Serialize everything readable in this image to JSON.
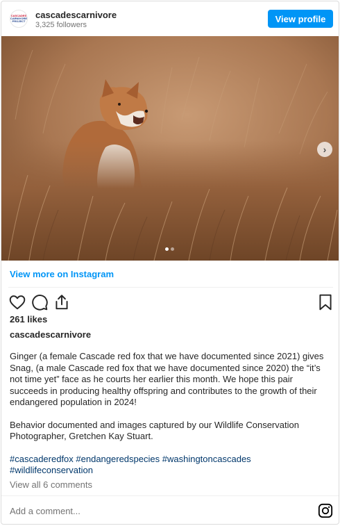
{
  "header": {
    "avatar_lines": [
      "CASCADES",
      "CARNIVORE",
      "PROJECT"
    ],
    "username": "cascadescarnivore",
    "followers": "3,325 followers",
    "view_profile_label": "View profile"
  },
  "media": {
    "slide_count": 2,
    "active_slide": 1,
    "next_icon": "chevron-right-icon"
  },
  "links": {
    "view_more": "View more on Instagram"
  },
  "actions": {
    "icons": [
      "heart-icon",
      "comment-icon",
      "share-icon",
      "bookmark-icon"
    ]
  },
  "post": {
    "likes": "261 likes",
    "caption_user": "cascadescarnivore",
    "paragraph_1": "Ginger (a female Cascade red fox that we have documented since 2021) gives Snag, (a male Cascade red fox that we have documented since 2020) the “it’s not time yet” face as he courts her earlier this month. We hope this pair succeeds in producing healthy offspring and contributes to the growth of their endangered population in 2024!",
    "paragraph_2": "Behavior documented and images captured by our Wildlife Conservation Photographer, Gretchen Kay Stuart.",
    "hashtags": [
      "#cascaderedfox",
      "#endangeredspecies",
      "#washingtoncascades",
      "#wildlifeconservation"
    ],
    "view_comments": "View all 6 comments"
  },
  "footer": {
    "add_comment_placeholder": "Add a comment...",
    "logo_icon": "instagram-icon"
  },
  "colors": {
    "accent": "#0095f6",
    "hashtag": "#00376b",
    "muted": "#737373"
  }
}
